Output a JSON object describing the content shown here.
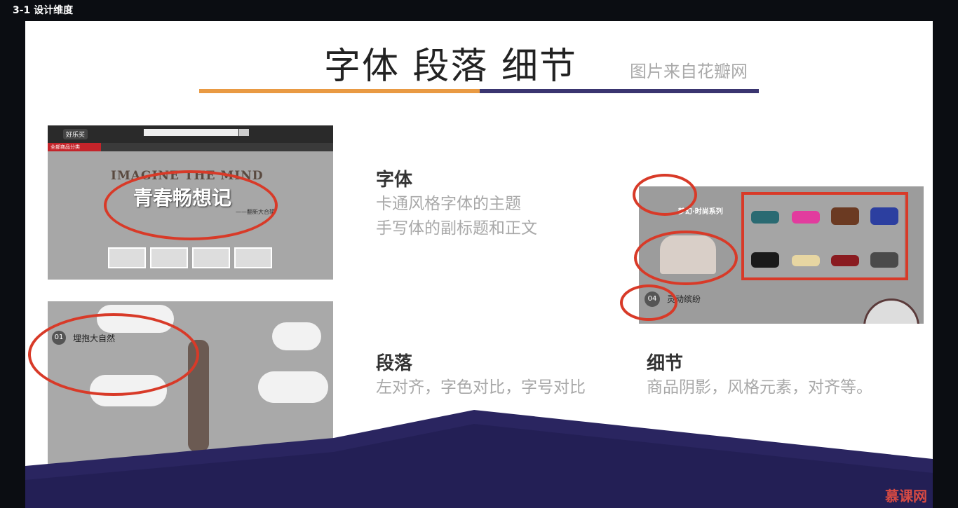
{
  "window": {
    "title": "3-1 设计维度"
  },
  "slide": {
    "title": "字体  段落  细节",
    "subtitle": "图片来自花瓣网",
    "sections": {
      "font": {
        "heading": "字体",
        "lines": [
          "卡通风格字体的主题",
          "手写体的副标题和正文"
        ]
      },
      "paragraph": {
        "heading": "段落",
        "lines": [
          "左对齐，字色对比，字号对比"
        ]
      },
      "detail": {
        "heading": "细节",
        "lines": [
          "商品阴影，风格元素，对齐等。"
        ]
      }
    },
    "screenshot1": {
      "brand": "好乐买",
      "category_label": "全部商品分类",
      "banner_en": "IMAGINE THE MIND",
      "banner_cn": "青春畅想记",
      "banner_sign": "——翻新大合辑"
    },
    "screenshot2": {
      "badge": "01",
      "heading": "埋抱大自然"
    },
    "screenshot3": {
      "series": "梦幻·时尚系列",
      "badge": "04",
      "heading": "灵动缤纷"
    },
    "logo": "慕课网",
    "colors": {
      "accent_orange": "#e99a43",
      "accent_navy": "#3a3570",
      "highlight_red": "#d83a28"
    }
  }
}
